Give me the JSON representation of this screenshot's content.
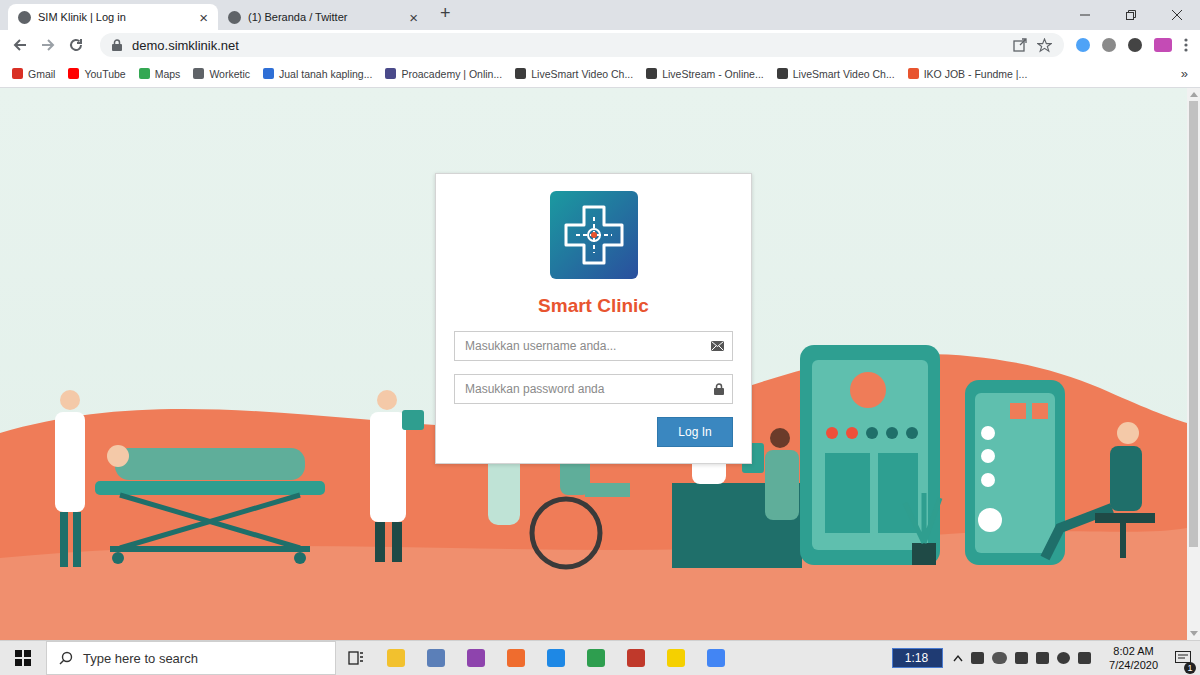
{
  "browser": {
    "tabs": [
      {
        "label": "SIM Klinik | Log in",
        "selected": true,
        "close": "×"
      },
      {
        "label": "(1) Beranda / Twitter",
        "selected": false,
        "close": "×"
      }
    ],
    "new_tab": "+",
    "address": "demo.simklinik.net",
    "bookmarks": [
      {
        "label": "Gmail",
        "color": "#d93025"
      },
      {
        "label": "YouTube",
        "color": "#ff0000"
      },
      {
        "label": "Maps",
        "color": "#34a853"
      },
      {
        "label": "Worketic",
        "color": "#5f6368"
      },
      {
        "label": "Jual tanah kapling...",
        "color": "#2f6fd6"
      },
      {
        "label": "Proacademy | Onlin...",
        "color": "#4a4a8a"
      },
      {
        "label": "LiveSmart Video Ch...",
        "color": "#3c3c3c"
      },
      {
        "label": "LiveStream - Online...",
        "color": "#3c3c3c"
      },
      {
        "label": "LiveSmart Video Ch...",
        "color": "#3c3c3c"
      },
      {
        "label": "IKO JOB - Fundme |...",
        "color": "#e8542f"
      }
    ],
    "bookmarks_more": "»"
  },
  "login": {
    "title": "Smart Clinic",
    "username_placeholder": "Masukkan username anda...",
    "password_placeholder": "Masukkan password anda",
    "button": "Log In"
  },
  "taskbar": {
    "search_placeholder": "Type here to search",
    "recorder": "1:18",
    "time": "8:02 AM",
    "date": "7/24/2020",
    "notifications": "1"
  }
}
